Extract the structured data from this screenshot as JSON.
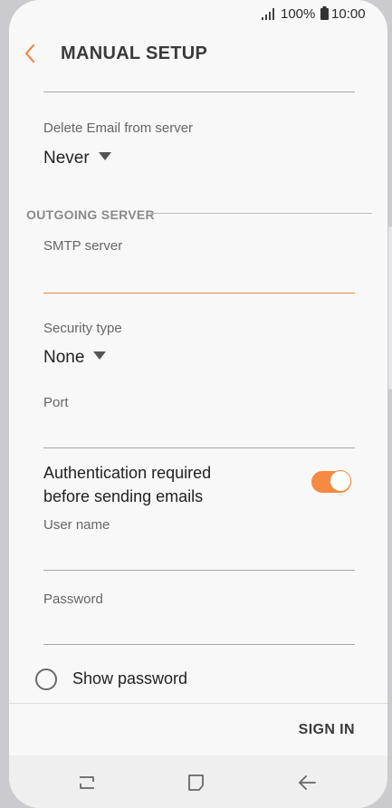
{
  "status_bar": {
    "battery_percent": "100%",
    "time": "10:00"
  },
  "header": {
    "title": "MANUAL SETUP"
  },
  "incoming": {
    "delete_email_label": "Delete Email from server",
    "delete_email_value": "Never"
  },
  "outgoing": {
    "section_title": "OUTGOING SERVER",
    "smtp_label": "SMTP server",
    "smtp_value": "",
    "security_label": "Security type",
    "security_value": "None",
    "port_label": "Port",
    "port_value": "",
    "auth_label_line1": "Authentication required",
    "auth_label_line2": "before sending emails",
    "auth_enabled": true,
    "username_label": "User name",
    "username_value": "",
    "password_label": "Password",
    "password_value": "",
    "show_password_label": "Show password",
    "show_password_checked": false
  },
  "footer": {
    "sign_in_label": "SIGN IN"
  },
  "colors": {
    "accent": "#f58a42",
    "focus_underline": "#e8884a"
  },
  "icons": {
    "back": "chevron-left-icon",
    "recent_apps": "recent-apps-icon",
    "home": "home-icon",
    "nav_back": "arrow-left-icon"
  }
}
